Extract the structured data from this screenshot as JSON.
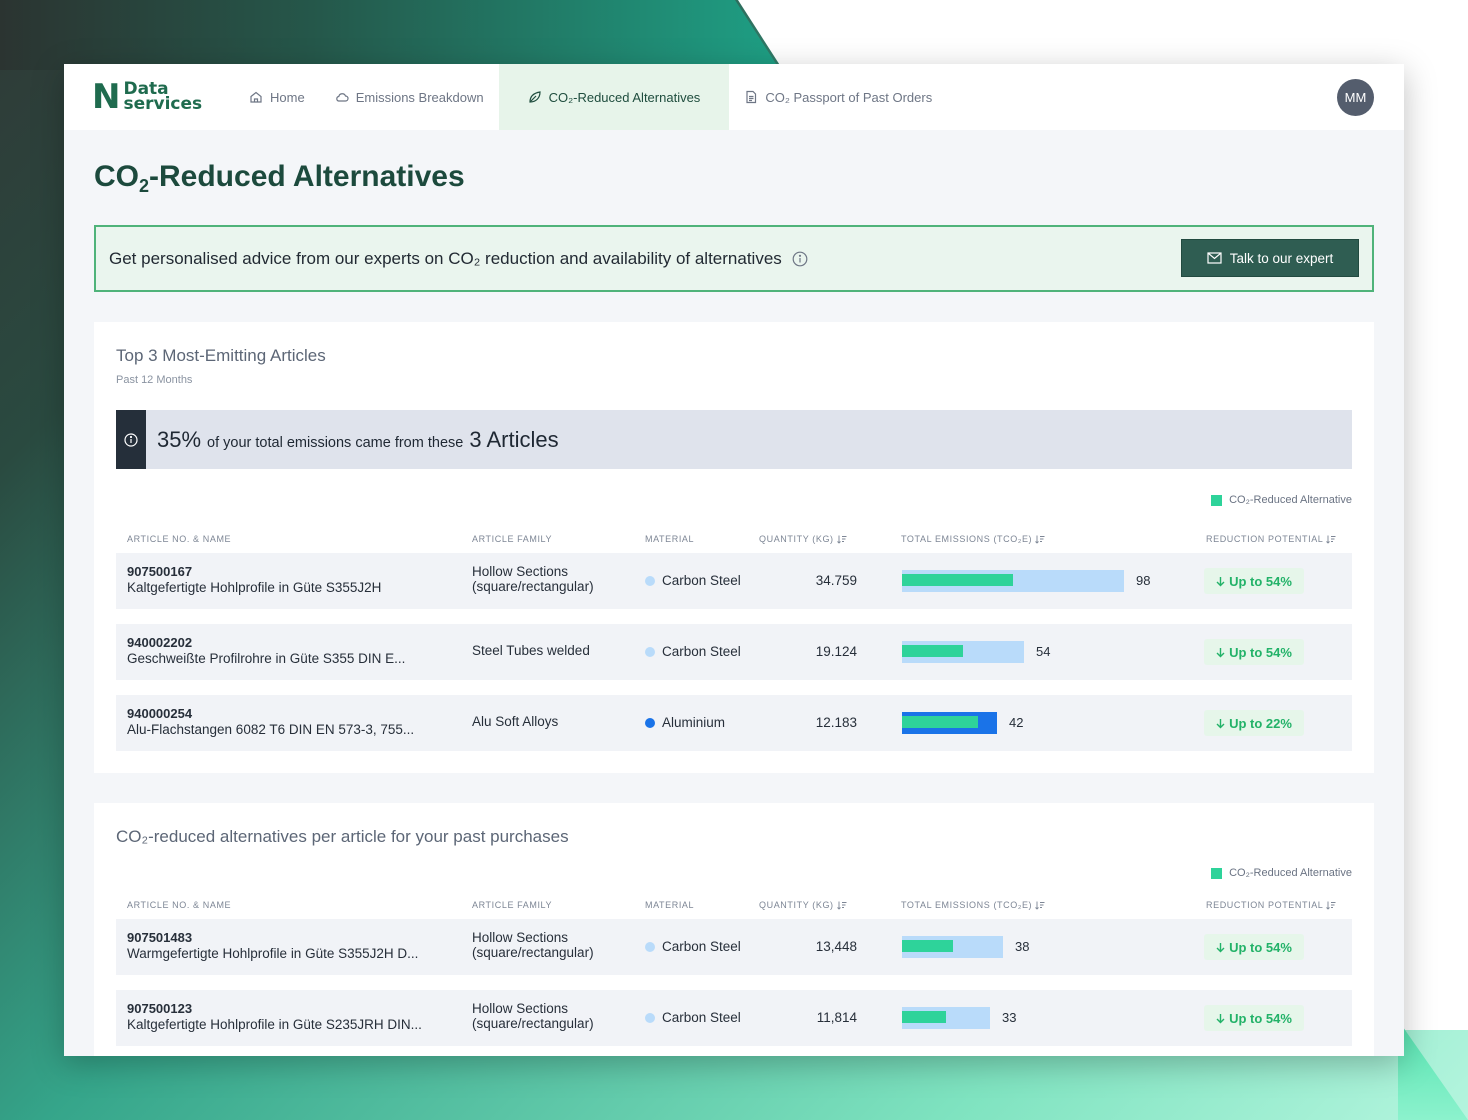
{
  "brand": {
    "logo_letter": "N",
    "logo_line1": "Data",
    "logo_line2": "services"
  },
  "nav": {
    "home": "Home",
    "emissions": "Emissions Breakdown",
    "alternatives": "CO₂-Reduced Alternatives",
    "passport": "CO₂ Passport of Past Orders"
  },
  "user": {
    "initials": "MM"
  },
  "page": {
    "title_pre": "CO",
    "title_sub": "2",
    "title_post": "-Reduced Alternatives"
  },
  "advice": {
    "text": "Get personalised advice from our experts on CO₂ reduction and availability of alternatives",
    "button": "Talk to our expert"
  },
  "top3": {
    "title": "Top 3 Most-Emitting Articles",
    "subtitle": "Past 12 Months",
    "banner_pct": "35%",
    "banner_text": "of your total emissions came from these",
    "banner_count": "3 Articles",
    "legend": "CO₂-Reduced Alternative",
    "headers": {
      "article": "ARTICLE NO. & NAME",
      "family": "ARTICLE FAMILY",
      "material": "MATERIAL",
      "quantity": "QUANTITY (KG)",
      "emissions": "TOTAL EMISSIONS (TCO₂E)",
      "reduction": "REDUCTION POTENTIAL"
    },
    "rows": [
      {
        "no": "907500167",
        "name": "Kaltgefertigte Hohlprofile in Güte S355J2H",
        "family1": "Hollow Sections",
        "family2": "(square/rectangular)",
        "material": "Carbon Steel",
        "material_color": "#b9dbfa",
        "qty": "34.759",
        "emissions": "98",
        "reduced_share": 0.5,
        "reduction": "Up to 54%"
      },
      {
        "no": "940002202",
        "name": "Geschweißte Profilrohre in Güte S355 DIN E...",
        "family1": "Steel Tubes welded",
        "family2": "",
        "material": "Carbon Steel",
        "material_color": "#b9dbfa",
        "qty": "19.124",
        "emissions": "54",
        "reduced_share": 0.5,
        "reduction": "Up to 54%"
      },
      {
        "no": "940000254",
        "name": "Alu-Flachstangen 6082 T6 DIN EN 573-3, 755...",
        "family1": "Alu Soft Alloys",
        "family2": "",
        "material": "Aluminium",
        "material_color": "#1a73e8",
        "qty": "12.183",
        "emissions": "42",
        "reduced_share": 0.8,
        "reduction": "Up to 22%"
      }
    ]
  },
  "alternatives": {
    "title": "CO₂-reduced alternatives per article for your past purchases",
    "legend": "CO₂-Reduced Alternative",
    "headers": {
      "article": "ARTICLE NO. & NAME",
      "family": "ARTICLE FAMILY",
      "material": "MATERIAL",
      "quantity": "QUANTITY (KG)",
      "emissions": "TOTAL EMISSIONS (TCO₂E)",
      "reduction": "REDUCTION POTENTIAL"
    },
    "rows": [
      {
        "no": "907501483",
        "name": "Warmgefertigte Hohlprofile in Güte S355J2H D...",
        "family1": "Hollow Sections",
        "family2": "(square/rectangular)",
        "material": "Carbon Steel",
        "material_color": "#b9dbfa",
        "qty": "13,448",
        "emissions": "38",
        "reduced_share": 0.5,
        "reduction": "Up to 54%"
      },
      {
        "no": "907500123",
        "name": "Kaltgefertigte Hohlprofile in Güte S235JRH DIN...",
        "family1": "Hollow Sections",
        "family2": "(square/rectangular)",
        "material": "Carbon Steel",
        "material_color": "#b9dbfa",
        "qty": "11,814",
        "emissions": "33",
        "reduced_share": 0.5,
        "reduction": "Up to 54%"
      }
    ]
  },
  "colors": {
    "accent": "#1f6b4e",
    "reduced": "#2ed39a",
    "track": "#b9dbfa",
    "badge_text": "#22b268"
  }
}
